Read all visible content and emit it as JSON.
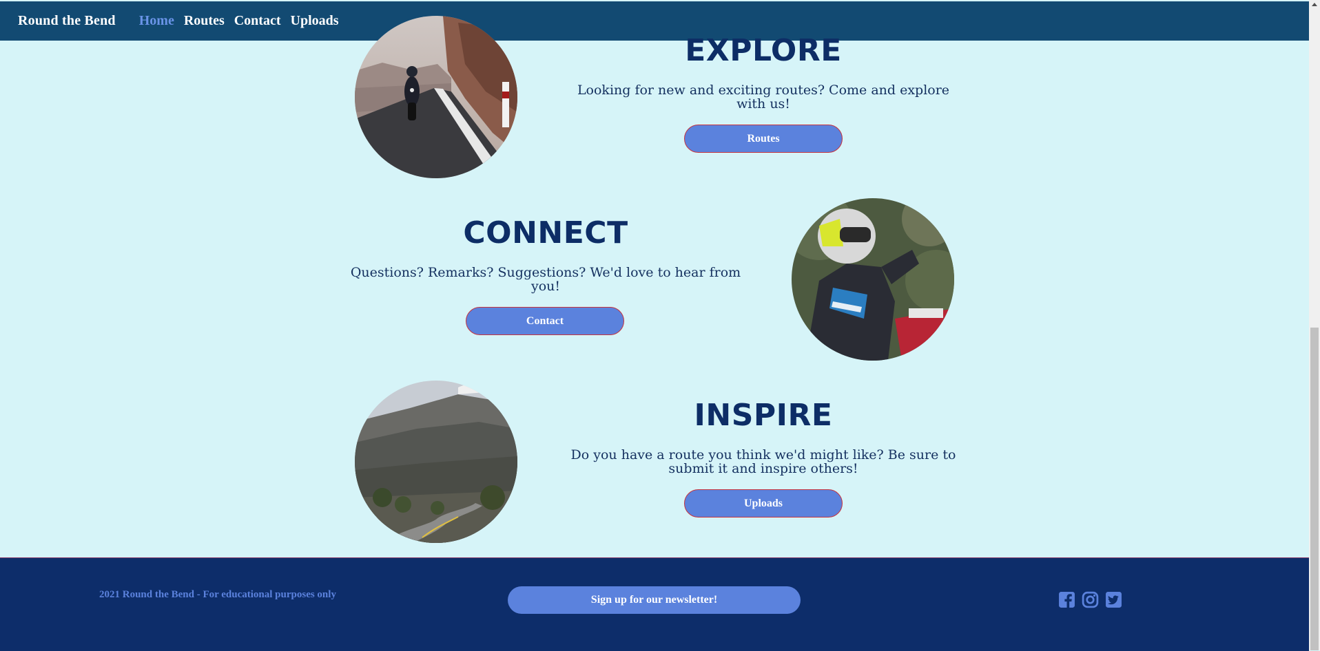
{
  "nav": {
    "brand": "Round the Bend",
    "links": [
      {
        "label": "Home",
        "active": true
      },
      {
        "label": "Routes",
        "active": false
      },
      {
        "label": "Contact",
        "active": false
      },
      {
        "label": "Uploads",
        "active": false
      }
    ]
  },
  "sections": {
    "explore": {
      "title": "EXPLORE",
      "text": "Looking for new and exciting routes? Come and explore with us!",
      "button": "Routes",
      "image": "motorcyclist-on-coastal-road"
    },
    "connect": {
      "title": "CONNECT",
      "text": "Questions? Remarks? Suggestions? We'd love to hear from you!",
      "button": "Contact",
      "image": "rider-in-helmet-on-motorcycle"
    },
    "inspire": {
      "title": "INSPIRE",
      "text": "Do you have a route you think we'd might like? Be sure to submit it and inspire others!",
      "button": "Uploads",
      "image": "winding-mountain-road"
    }
  },
  "footer": {
    "note": "2021 Round the Bend - For educational purposes only",
    "newsletter_button": "Sign up for our newsletter!",
    "social_icons": [
      "facebook-icon",
      "instagram-icon",
      "twitter-icon"
    ]
  },
  "colors": {
    "page_background": "#d6f4f8",
    "navbar": "#124a72",
    "accent": "#5b82dd",
    "heading": "#0d2d66",
    "footer": "#0d2d6a",
    "button_border": "#c8323c"
  }
}
